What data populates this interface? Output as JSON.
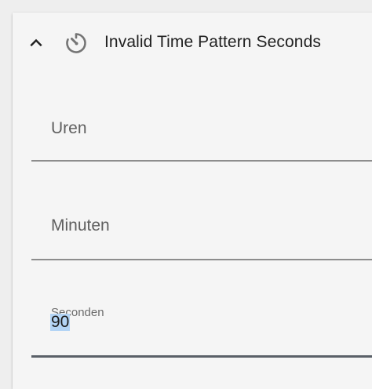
{
  "card": {
    "title": "Invalid Time Pattern Seconds",
    "collapse_icon": "chevron-up-icon",
    "trigger_icon": "timer-icon"
  },
  "fields": {
    "hours": {
      "label": "Uren",
      "value": ""
    },
    "minutes": {
      "label": "Minuten",
      "value": ""
    },
    "seconds": {
      "label": "Seconden",
      "value": "90"
    }
  },
  "colors": {
    "card_background": "#f5f5f5",
    "selection_highlight": "#b3d4f5",
    "active_underline": "#5a6068"
  }
}
